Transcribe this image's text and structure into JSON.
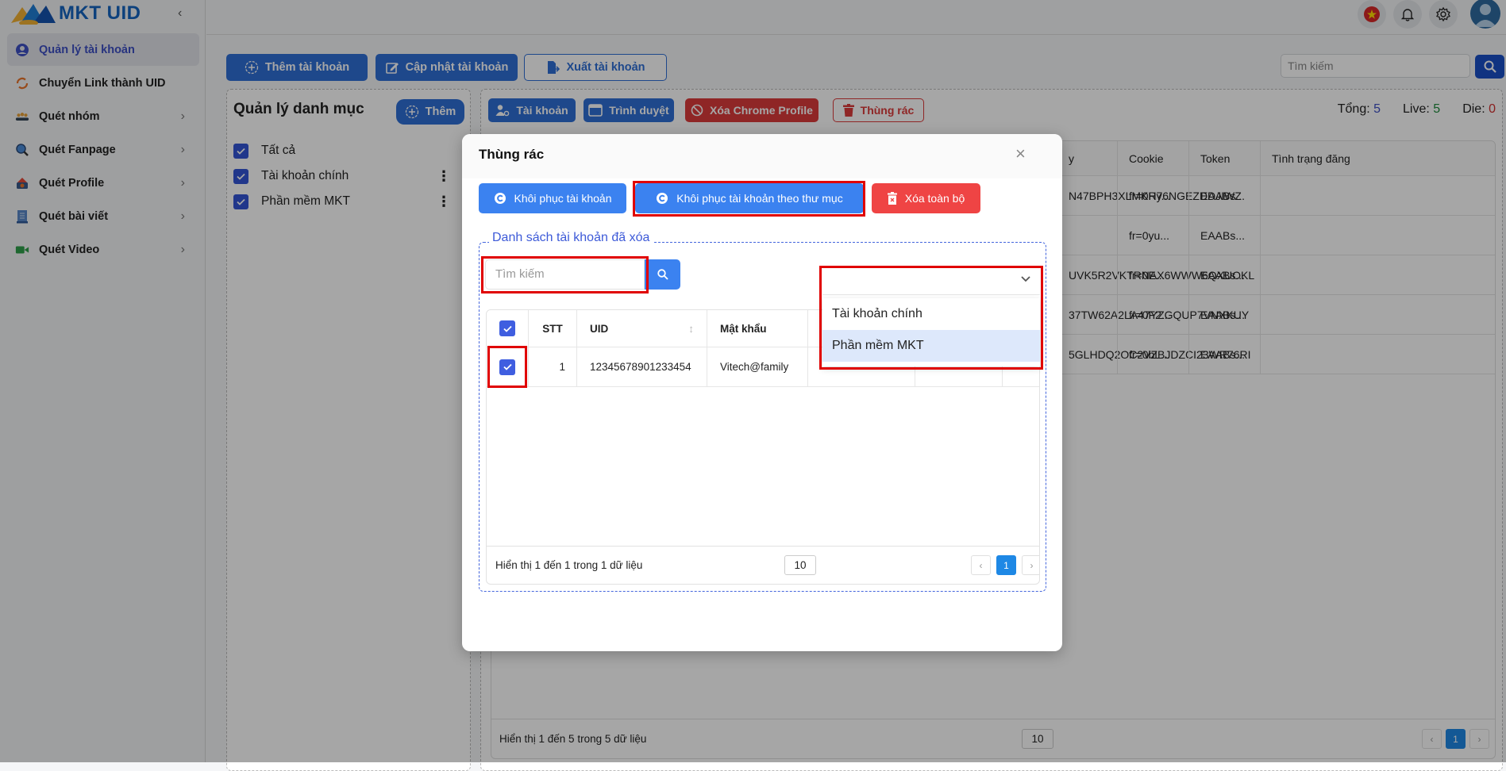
{
  "app": {
    "logo_text": "MKT UID"
  },
  "sidebar": {
    "items": [
      {
        "label": "Quản lý tài khoản",
        "icon": "user-circle-icon",
        "active": true,
        "has_submenu": false
      },
      {
        "label": "Chuyển Link thành UID",
        "icon": "refresh-icon",
        "active": false,
        "has_submenu": false
      },
      {
        "label": "Quét nhóm",
        "icon": "group-icon",
        "active": false,
        "has_submenu": true
      },
      {
        "label": "Quét Fanpage",
        "icon": "search-icon",
        "active": false,
        "has_submenu": true
      },
      {
        "label": "Quét Profile",
        "icon": "profile-icon",
        "active": false,
        "has_submenu": true
      },
      {
        "label": "Quét bài viết",
        "icon": "document-icon",
        "active": false,
        "has_submenu": true
      },
      {
        "label": "Quét Video",
        "icon": "video-icon",
        "active": false,
        "has_submenu": true
      }
    ]
  },
  "header": {
    "icons": [
      "vietnam-flag-icon",
      "bell-icon",
      "gear-icon",
      "avatar"
    ]
  },
  "toolbar": {
    "add_account": "Thêm tài khoản",
    "update_account": "Cập nhật tài khoản",
    "export_account": "Xuất tài khoản",
    "search_placeholder": "Tìm kiếm"
  },
  "categories": {
    "title": "Quản lý danh mục",
    "add_label": "Thêm",
    "items": [
      {
        "label": "Tất cả",
        "checked": true,
        "menu": false
      },
      {
        "label": "Tài khoản chính",
        "checked": true,
        "menu": true
      },
      {
        "label": "Phần mềm MKT",
        "checked": true,
        "menu": true
      }
    ]
  },
  "main": {
    "buttons": {
      "accounts": "Tài khoản",
      "browser": "Trình duyệt",
      "delete_chrome_profile": "Xóa Chrome Profile",
      "trash": "Thùng rác"
    },
    "counts": {
      "total_label": "Tổng:",
      "total": "5",
      "live_label": "Live:",
      "live": "5",
      "die_label": "Die:",
      "die": "0"
    },
    "colors": {
      "total": "#3d4fc4",
      "live": "#1e8a3c",
      "die": "#d32f2f"
    },
    "table": {
      "headers": [
        "y",
        "Cookie",
        "Token",
        "Tình trạng đăng"
      ],
      "rows": [
        [
          "N47BPH3XLMKR76NGEZDDJIWZ",
          "fr=0Hy...",
          "EAABs...",
          ""
        ],
        [
          "",
          "fr=0yu...",
          "EAABs...",
          ""
        ],
        [
          "UVK5R2VKTRNAX6WWW6QXUOKL",
          "fr=0E...",
          "EAABs...",
          ""
        ],
        [
          "37TW62A2LA47YZGQUP7VNXKUY",
          "fr=0F2...",
          "EAABs...",
          ""
        ],
        [
          "5GLHDQ2OC2VZBJDZCI23WR76RI",
          "fr=0bL...",
          "EAABs...",
          ""
        ]
      ]
    },
    "footer": {
      "info": "Hiển thị 1 đến 5 trong 5 dữ liệu",
      "page_size": "10",
      "page": "1"
    }
  },
  "modal": {
    "title": "Thùng rác",
    "buttons": {
      "restore": "Khôi phục tài khoản",
      "restore_by_folder": "Khôi phục tài khoản theo thư mục",
      "delete_all": "Xóa toàn bộ"
    },
    "section_title": "Danh sách tài khoản đã xóa",
    "search_placeholder": "Tìm kiếm",
    "dropdown": {
      "selected": "",
      "options": [
        {
          "label": "Tài khoản chính",
          "highlighted": false
        },
        {
          "label": "Phần mềm MKT",
          "highlighted": true
        }
      ]
    },
    "table": {
      "headers": [
        "STT",
        "UID",
        "Mật khẩu"
      ],
      "rows": [
        {
          "checked": true,
          "stt": "1",
          "uid": "12345678901233454",
          "password": "Vitech@family"
        }
      ],
      "select_all_checked": true
    },
    "footer": {
      "info": "Hiển thị 1 đến 1 trong 1 dữ liệu",
      "page_size": "10",
      "page": "1"
    }
  }
}
